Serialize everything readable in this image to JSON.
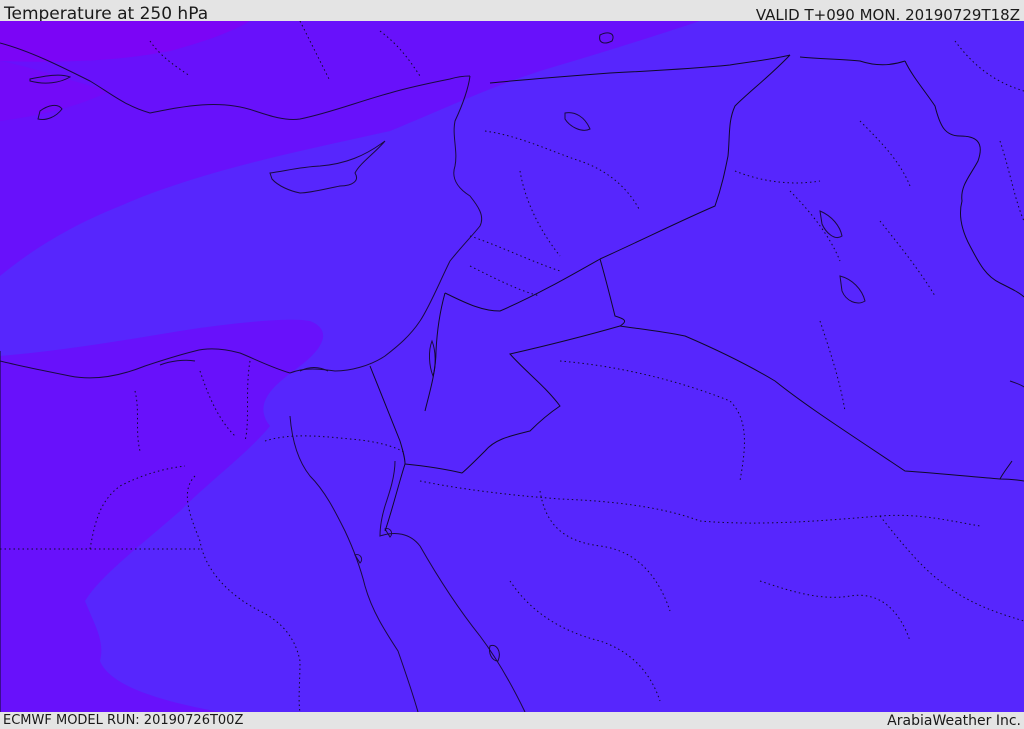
{
  "header": {
    "title": "Temperature at 250 hPa",
    "valid_time": "VALID T+090 MON. 20190729T18Z"
  },
  "footer": {
    "model_run": "ECMWF MODEL RUN: 20190726T00Z",
    "credit": "ArabiaWeather Inc."
  },
  "map": {
    "colors": {
      "warm_zone": "#5726fd",
      "cooler_zone": "#6811fb",
      "coldest_zone": "#7b05f6",
      "coastline": "#1a0a40",
      "border_line": "#10092a"
    }
  }
}
